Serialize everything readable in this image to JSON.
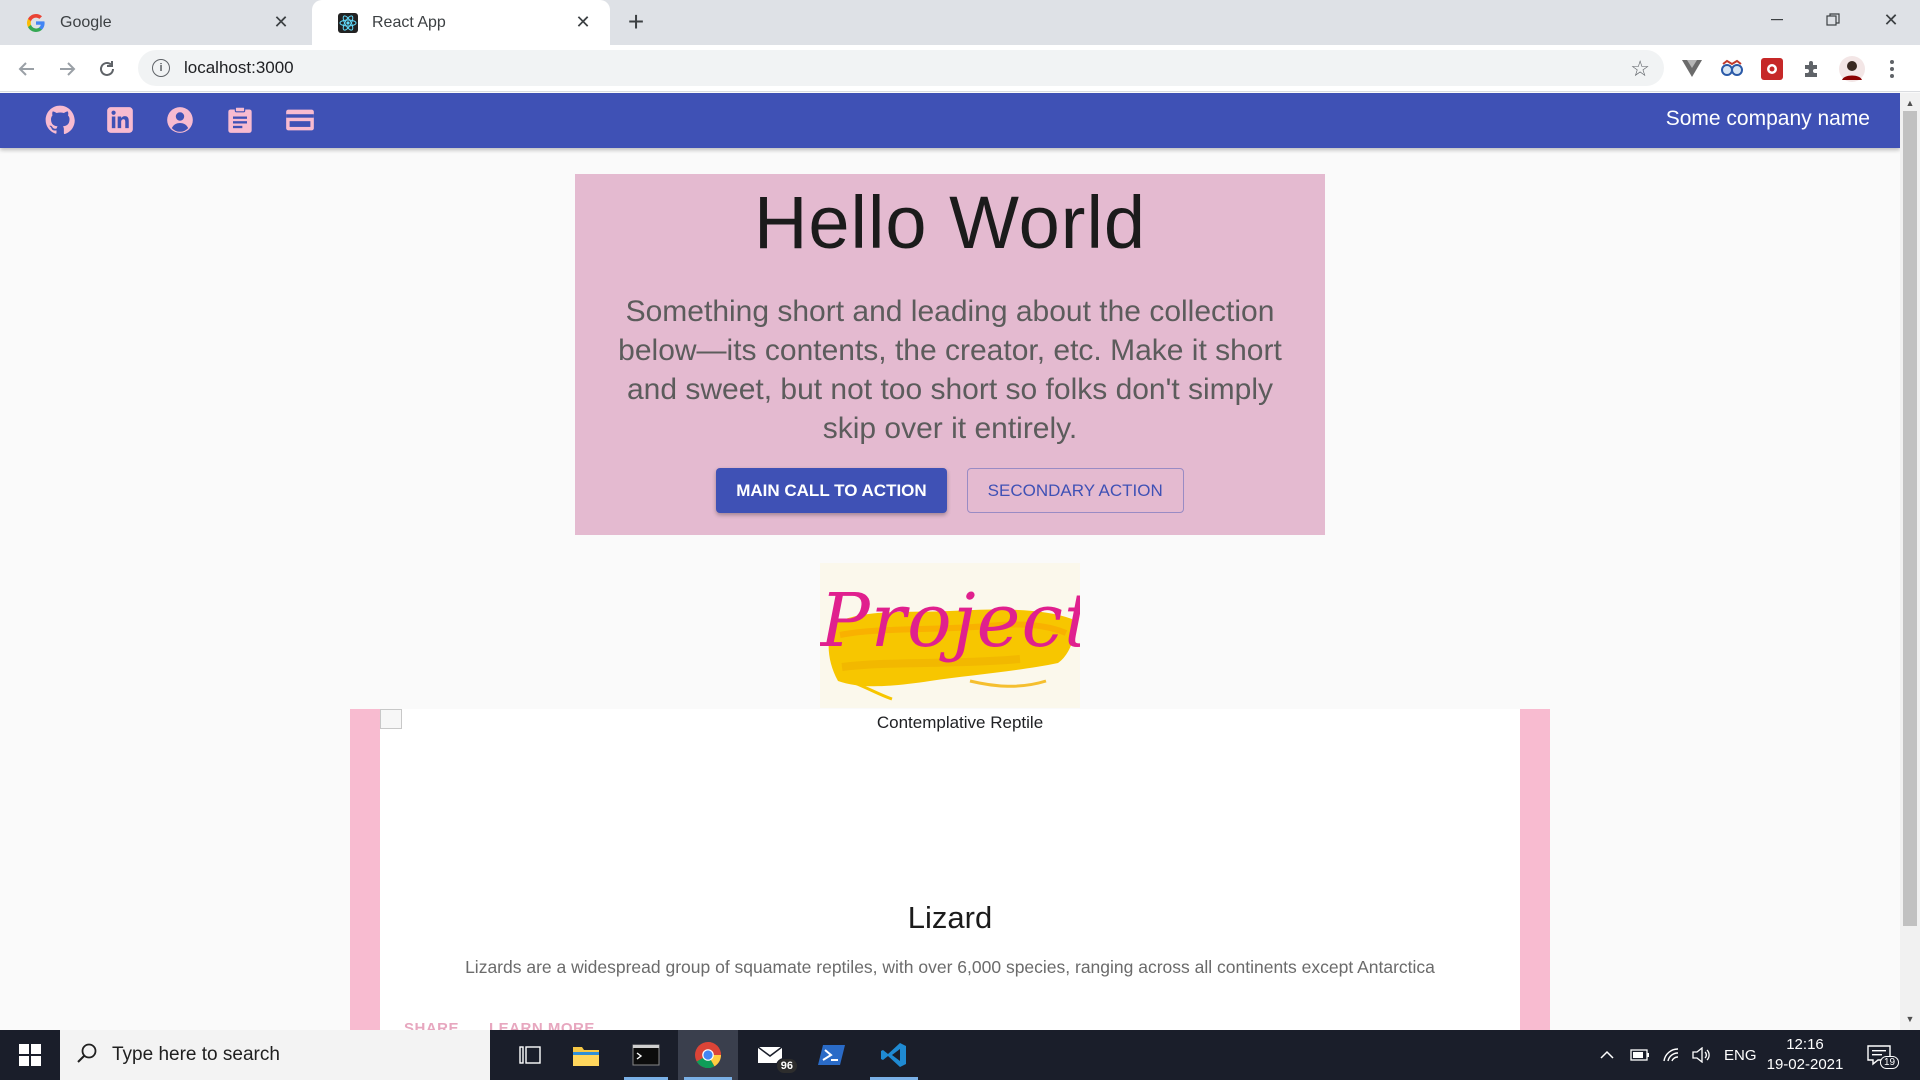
{
  "browser": {
    "tabs": [
      {
        "title": "Google",
        "active": false
      },
      {
        "title": "React App",
        "active": true
      }
    ],
    "url": "localhost:3000"
  },
  "appbar": {
    "icons": [
      "github-icon",
      "linkedin-icon",
      "account-icon",
      "clipboard-icon",
      "credit-card-icon"
    ],
    "company": "Some company name",
    "color": "#3f51b5"
  },
  "hero": {
    "title": "Hello World",
    "subtitle": "Something short and leading about the collection below—its contents, the creator, etc. Make it short and sweet, but not too short so folks don't simply skip over it entirely.",
    "primary_label": "MAIN CALL TO ACTION",
    "secondary_label": "SECONDARY ACTION",
    "background": "#e4bad0"
  },
  "projects": {
    "heading": "Projects"
  },
  "card": {
    "image_alt": "Contemplative Reptile",
    "title": "Lizard",
    "description": "Lizards are a widespread group of squamate reptiles, with over 6,000 species, ranging across all continents except Antarctica",
    "share_label": "SHARE",
    "learn_more_label": "LEARN MORE",
    "accent": "#f8bbd0"
  },
  "taskbar": {
    "search_placeholder": "Type here to search",
    "mail_badge": "96",
    "language": "ENG",
    "time": "12:16",
    "date": "19-02-2021",
    "notification_count": "19"
  }
}
